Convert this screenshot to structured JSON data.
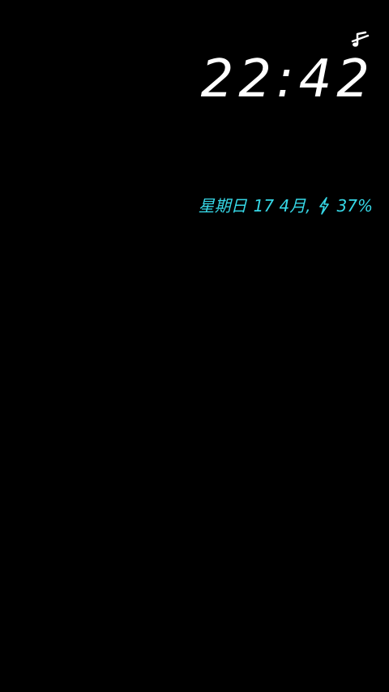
{
  "status_bar": {
    "icon": "muted-note-icon"
  },
  "lockscreen": {
    "time": "22:42",
    "weekday": "星期日",
    "date": "17 4月,",
    "battery_icon": "charging-bolt-icon",
    "battery_percent": "37%"
  },
  "colors": {
    "background": "#000000",
    "clock": "#ffffff",
    "info": "#36d7e6"
  }
}
